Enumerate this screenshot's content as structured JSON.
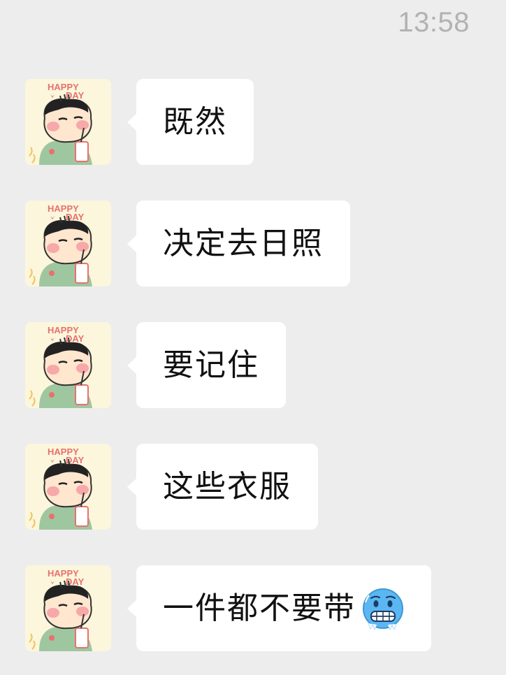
{
  "status": {
    "timestamp": "13:58"
  },
  "avatar": {
    "caption_line1": "HAPPY",
    "caption_line2": "DAY",
    "icon": "cartoon-boy-drinking-avatar"
  },
  "messages": [
    {
      "text": "既然"
    },
    {
      "text": "决定去日照"
    },
    {
      "text": "要记住"
    },
    {
      "text": "这些衣服"
    },
    {
      "text": "一件都不要带",
      "emoji": "freezing-face-icon"
    }
  ],
  "colors": {
    "background": "#ededed",
    "bubble": "#ffffff",
    "text": "#111111",
    "timestamp": "#b2b2b2",
    "emoji_blue": "#5bb7f2"
  }
}
